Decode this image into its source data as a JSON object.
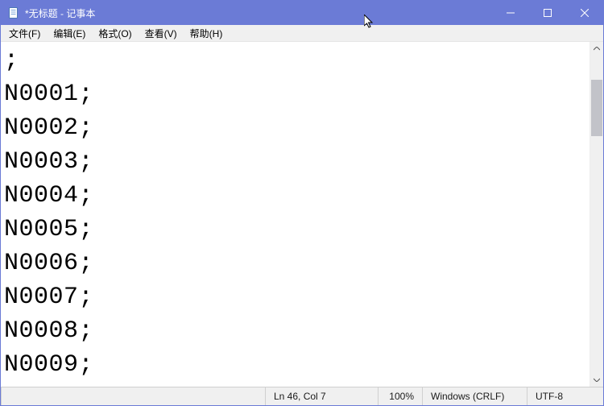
{
  "titlebar": {
    "title": "*无标题 - 记事本"
  },
  "menubar": {
    "items": [
      {
        "label": "文件(F)"
      },
      {
        "label": "编辑(E)"
      },
      {
        "label": "格式(O)"
      },
      {
        "label": "查看(V)"
      },
      {
        "label": "帮助(H)"
      }
    ]
  },
  "editor": {
    "content": ";\nN0001;\nN0002;\nN0003;\nN0004;\nN0005;\nN0006;\nN0007;\nN0008;\nN0009;"
  },
  "statusbar": {
    "lncol": "Ln 46,  Col 7",
    "zoom": "100%",
    "eol": "Windows (CRLF)",
    "encoding": "UTF-8"
  },
  "icons": {
    "app": "notepad-icon",
    "minimize": "minimize-icon",
    "maximize": "maximize-icon",
    "close": "close-icon",
    "scroll_up": "chevron-up-icon",
    "scroll_down": "chevron-down-icon"
  }
}
